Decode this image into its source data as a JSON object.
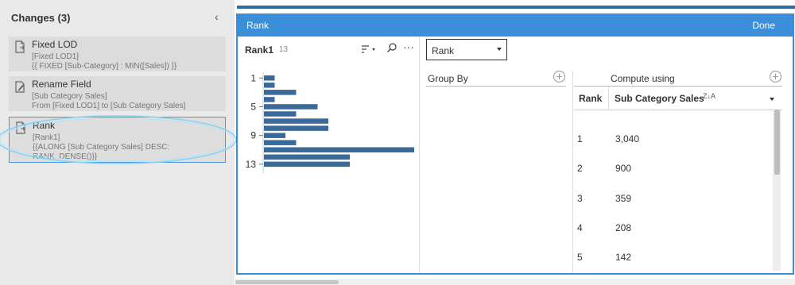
{
  "changes_panel": {
    "title": "Changes (3)",
    "items": [
      {
        "title": "Fixed LOD",
        "line2": "[Fixed LOD1]",
        "line3": "{{ FIXED [Sub-Category] : MIN([Sales]) }}",
        "line4": ""
      },
      {
        "title": "Rename Field",
        "line2": "[Sub Category Sales]",
        "line3": "From [Fixed LOD1] to [Sub Category Sales]",
        "line4": ""
      },
      {
        "title": "Rank",
        "line2": "[Rank1]",
        "line3": "{{ALONG [Sub Category Sales] DESC:",
        "line4": "RANK_DENSE()}}"
      }
    ],
    "highlight_color": "#89d3f5"
  },
  "rank_panel": {
    "title": "Rank",
    "done_label": "Done",
    "accent_color": "#3a8fd8"
  },
  "profile": {
    "field_name": "Rank1",
    "count": "13",
    "axis_labels": [
      "1",
      "5",
      "9",
      "13"
    ],
    "bar_color": "#3b6a9a"
  },
  "chart_data": {
    "type": "bar",
    "orientation": "horizontal",
    "categories": [
      "1",
      "2",
      "3",
      "4",
      "5",
      "6",
      "7",
      "8",
      "9",
      "10",
      "11",
      "12",
      "13"
    ],
    "values": [
      1,
      1,
      3,
      1,
      5,
      3,
      6,
      6,
      2,
      3,
      14,
      8,
      8
    ],
    "tick_labels": [
      "1",
      "5",
      "9",
      "13"
    ]
  },
  "config": {
    "calc_type": "Rank",
    "group_by_label": "Group By",
    "compute_using_label": "Compute using",
    "table": {
      "headers": {
        "rank": "Rank",
        "field": "Sub Category Sales",
        "sort_glyph": "Z↓A"
      },
      "rows": [
        {
          "rank": "1",
          "value": "3,040"
        },
        {
          "rank": "2",
          "value": "900"
        },
        {
          "rank": "3",
          "value": "359"
        },
        {
          "rank": "4",
          "value": "208"
        },
        {
          "rank": "5",
          "value": "142"
        }
      ]
    }
  }
}
